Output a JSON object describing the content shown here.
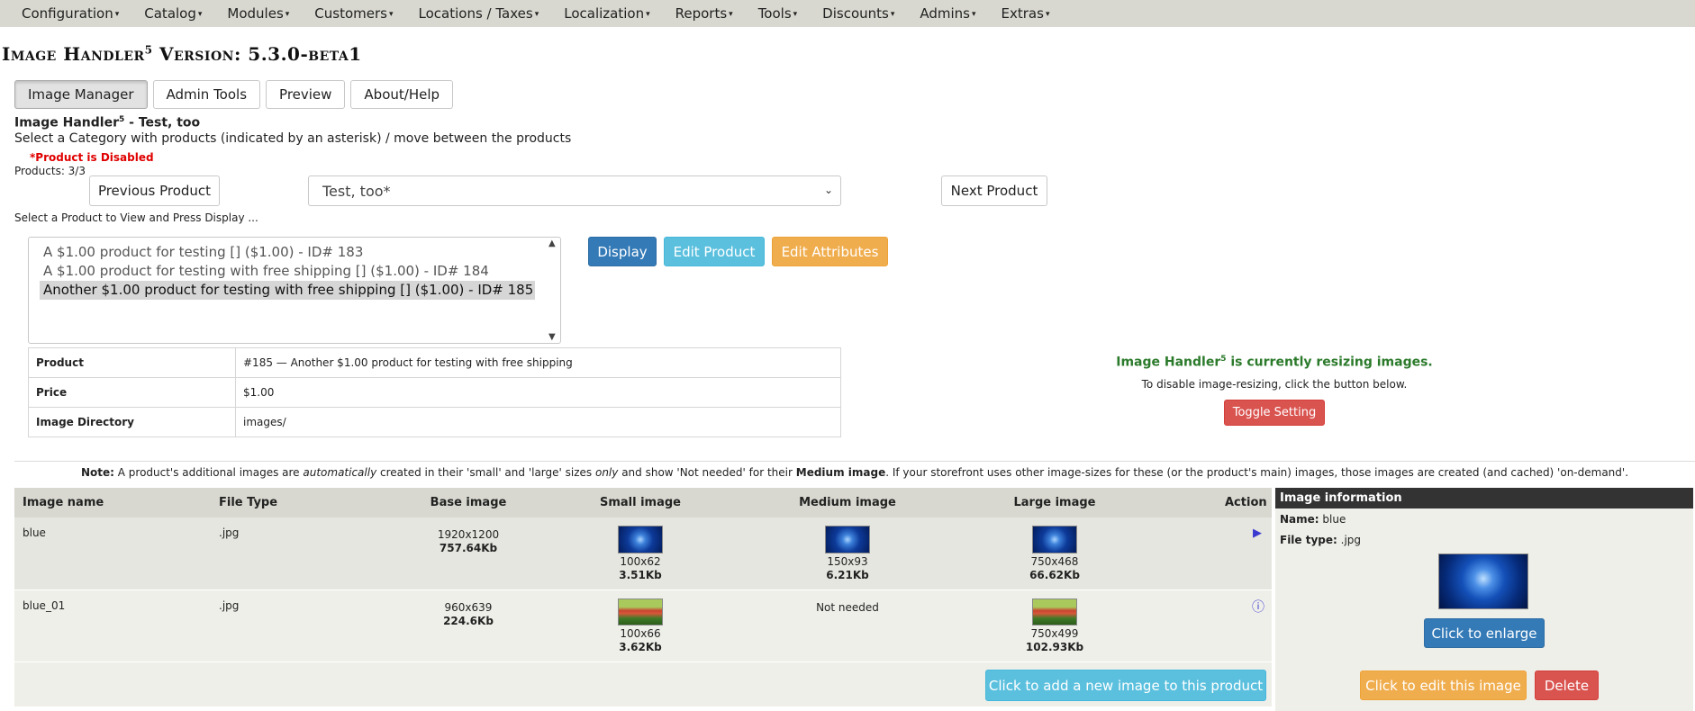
{
  "nav": {
    "items": [
      {
        "label": "Configuration"
      },
      {
        "label": "Catalog"
      },
      {
        "label": "Modules"
      },
      {
        "label": "Customers"
      },
      {
        "label": "Locations / Taxes"
      },
      {
        "label": "Localization"
      },
      {
        "label": "Reports"
      },
      {
        "label": "Tools"
      },
      {
        "label": "Discounts"
      },
      {
        "label": "Admins"
      },
      {
        "label": "Extras"
      }
    ],
    "caret": "▾"
  },
  "title": {
    "prefix": "Image Handler",
    "sup": "5",
    "version": " Version: 5.3.0-beta1"
  },
  "tabs": {
    "items": [
      {
        "label": "Image Manager"
      },
      {
        "label": "Admin Tools"
      },
      {
        "label": "Preview"
      },
      {
        "label": "About/Help"
      }
    ]
  },
  "section": {
    "heading_prefix": "Image Handler",
    "heading_sup": "5",
    "heading_suffix": " - Test, too",
    "instruction": "Select a Category with products (indicated by an asterisk) / move between the products",
    "disabled_note": "*Product is Disabled",
    "products_count": "Products: 3/3"
  },
  "navigation": {
    "prev_label": "Previous Product",
    "next_label": "Next Product",
    "category_value": "Test, too*"
  },
  "product_list": {
    "hint": "Select a Product to View and Press Display ...",
    "options": [
      {
        "label": "A $1.00 product for testing [] ($1.00) - ID# 183"
      },
      {
        "label": "A $1.00 product for testing with free shipping [] ($1.00) - ID# 184"
      },
      {
        "label": "Another $1.00 product for testing with free shipping [] ($1.00) - ID# 185"
      }
    ]
  },
  "actions": {
    "display_label": "Display",
    "edit_product_label": "Edit Product",
    "edit_attributes_label": "Edit Attributes"
  },
  "product_info": {
    "rows": [
      {
        "label": "Product",
        "value": "#185 — Another $1.00 product for testing with free shipping"
      },
      {
        "label": "Price",
        "value": "$1.00"
      },
      {
        "label": "Image Directory",
        "value": "images/"
      }
    ]
  },
  "resize": {
    "status_prefix": "Image Handler",
    "status_sup": "5",
    "status_suffix": " is currently resizing images.",
    "hint": "To disable image-resizing, click the button below.",
    "toggle_label": "Toggle Setting"
  },
  "note": {
    "label": "Note:",
    "t1": " A product's additional images are ",
    "i1": "automatically",
    "t2": " created in their 'small' and 'large' sizes ",
    "i2": "only",
    "t3": " and show 'Not needed' for their ",
    "b1": "Medium image",
    "t4": ". If your storefront uses other image-sizes for these (or the product's main) images, those images are created (and cached) 'on-demand'."
  },
  "images_table": {
    "headers": {
      "name": "Image name",
      "type": "File Type",
      "base": "Base image",
      "small": "Small image",
      "medium": "Medium image",
      "large": "Large image",
      "action": "Action"
    },
    "rows": [
      {
        "name": "blue",
        "type": ".jpg",
        "base_dim": "1920x1200",
        "base_size": "757.64Kb",
        "small_dim": "100x62",
        "small_size": "3.51Kb",
        "medium_dim": "150x93",
        "medium_size": "6.21Kb",
        "large_dim": "750x468",
        "large_size": "66.62Kb",
        "action_icon": "▶"
      },
      {
        "name": "blue_01",
        "type": ".jpg",
        "base_dim": "960x639",
        "base_size": "224.6Kb",
        "small_dim": "100x66",
        "small_size": "3.62Kb",
        "medium_text": "Not needed",
        "large_dim": "750x499",
        "large_size": "102.93Kb",
        "action_icon": "ⓘ"
      }
    ],
    "add_label": "Click to add a new image to this product"
  },
  "image_info": {
    "header": "Image information",
    "name_label": "Name:",
    "name_value": " blue",
    "type_label": "File type:",
    "type_value": " .jpg",
    "enlarge_label": "Click to enlarge",
    "edit_label": "Click to edit this image",
    "delete_label": "Delete"
  },
  "colors": {
    "primary": "#337ab7",
    "info": "#5bc0de",
    "warning": "#f0ad4e",
    "danger": "#d9534f",
    "success_text": "#2b7a2b",
    "disabled_text": "#e00000"
  }
}
